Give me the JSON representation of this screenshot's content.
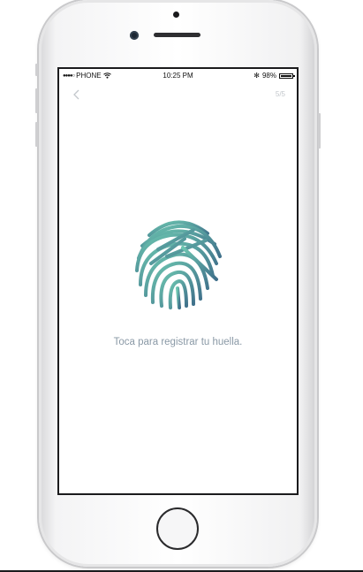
{
  "status_bar": {
    "signal_dots": "●●●●○",
    "carrier": "PHONE",
    "time": "10:25 PM",
    "bluetooth": "✻",
    "battery_text": "98%",
    "battery_level": 0.98
  },
  "header": {
    "back_glyph": "<",
    "step": "5/5"
  },
  "main": {
    "prompt": "Toca para registrar tu huella."
  },
  "colors": {
    "fingerprint_top": "#6cc5b0",
    "fingerprint_bottom": "#3f6f8a",
    "prompt_text": "#8a99a6"
  },
  "icons": {
    "back": "chevron-left-icon",
    "fingerprint": "fingerprint-icon",
    "wifi": "wifi-icon",
    "bluetooth": "bluetooth-icon",
    "battery": "battery-icon"
  }
}
